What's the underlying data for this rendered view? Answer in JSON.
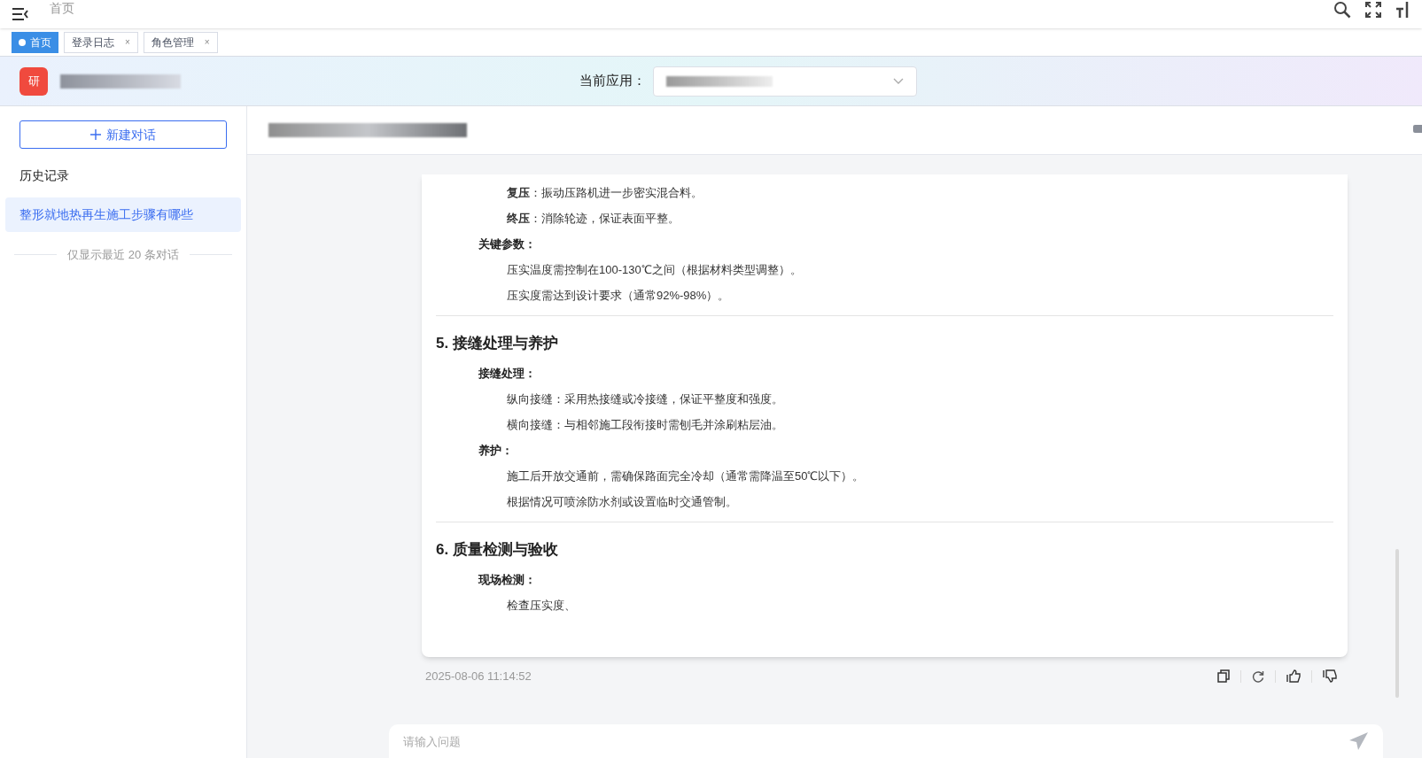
{
  "topbar": {
    "breadcrumb": "首页"
  },
  "tabs": [
    {
      "label": "首页",
      "selected": true
    },
    {
      "label": "登录日志",
      "selected": false,
      "close": "×"
    },
    {
      "label": "角色管理",
      "selected": false,
      "close": "×"
    }
  ],
  "header": {
    "logo": "研",
    "app_label": "当前应用："
  },
  "sidebar": {
    "new_chat": "新建对话",
    "history_title": "历史记录",
    "items": [
      {
        "label": "整形就地热再生施工步骤有哪些",
        "selected": true
      }
    ],
    "footer_note": "仅显示最近 20 条对话"
  },
  "answer": {
    "blocks": [
      {
        "kind": "item",
        "text": "**复压**：振动压路机进一步密实混合料。"
      },
      {
        "kind": "item",
        "text": "**终压**：消除轮迹，保证表面平整。"
      },
      {
        "kind": "label",
        "text": "关键参数："
      },
      {
        "kind": "item",
        "text": "压实温度需控制在100-130℃之间（根据材料类型调整）。"
      },
      {
        "kind": "item",
        "text": "压实度需达到设计要求（通常92%-98%）。"
      },
      {
        "kind": "divider"
      },
      {
        "kind": "heading",
        "text": "5. 接缝处理与养护"
      },
      {
        "kind": "label",
        "text": "接缝处理："
      },
      {
        "kind": "item",
        "text": "纵向接缝：采用热接缝或冷接缝，保证平整度和强度。"
      },
      {
        "kind": "item",
        "text": "横向接缝：与相邻施工段衔接时需刨毛并涂刷粘层油。"
      },
      {
        "kind": "label",
        "text": "养护："
      },
      {
        "kind": "item",
        "text": "施工后开放交通前，需确保路面完全冷却（通常需降温至50℃以下）。"
      },
      {
        "kind": "item",
        "text": "根据情况可喷涂防水剂或设置临时交通管制。"
      },
      {
        "kind": "divider"
      },
      {
        "kind": "heading",
        "text": "6. 质量检测与验收"
      },
      {
        "kind": "label",
        "text": "现场检测："
      },
      {
        "kind": "item",
        "text": "检查压实度、"
      }
    ],
    "timestamp": "2025-08-06 11:14:52"
  },
  "input": {
    "placeholder": "请输入问题"
  }
}
